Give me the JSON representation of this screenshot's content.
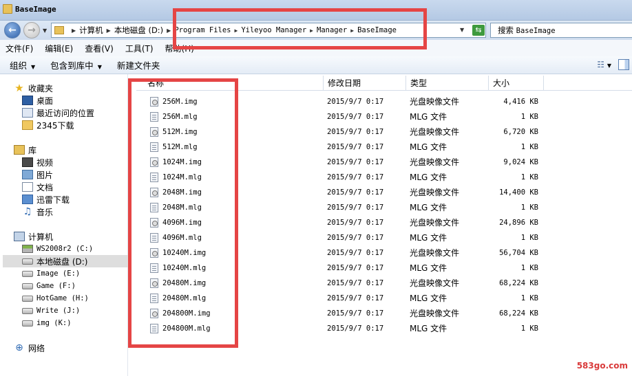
{
  "window": {
    "title": "BaseImage"
  },
  "nav": {
    "back_arrow": "←",
    "forward_arrow": "→",
    "breadcrumbs": [
      "计算机",
      "本地磁盘 (D:)",
      "Program Files",
      "Yileyoo Manager",
      "Manager",
      "BaseImage"
    ],
    "search_placeholder": "搜索 BaseImage",
    "search_prefix": "搜索",
    "search_target": "BaseImage"
  },
  "menubar": [
    "文件(F)",
    "编辑(E)",
    "查看(V)",
    "工具(T)",
    "帮助(H)"
  ],
  "toolbar": {
    "organize": "组织",
    "include_in_library": "包含到库中",
    "new_folder": "新建文件夹"
  },
  "sidebar": {
    "favorites": {
      "label": "收藏夹",
      "items": [
        "桌面",
        "最近访问的位置",
        "2345下载"
      ]
    },
    "libraries": {
      "label": "库",
      "items": [
        "视频",
        "图片",
        "文档",
        "迅雷下载",
        "音乐"
      ]
    },
    "computer": {
      "label": "计算机",
      "drives": [
        "WS2008r2 (C:)",
        "本地磁盘 (D:)",
        "Image (E:)",
        "Game (F:)",
        "HotGame (H:)",
        "Write (J:)",
        "img (K:)"
      ],
      "selected_index": 1
    },
    "network": {
      "label": "网络"
    }
  },
  "columns": {
    "name": "名称",
    "date": "修改日期",
    "type": "类型",
    "size": "大小"
  },
  "files": [
    {
      "name": "256M.img",
      "date": "2015/9/7 0:17",
      "type": "光盘映像文件",
      "size": "4,416 KB",
      "kind": "img"
    },
    {
      "name": "256M.mlg",
      "date": "2015/9/7 0:17",
      "type": "MLG 文件",
      "size": "1 KB",
      "kind": "mlg"
    },
    {
      "name": "512M.img",
      "date": "2015/9/7 0:17",
      "type": "光盘映像文件",
      "size": "6,720 KB",
      "kind": "img"
    },
    {
      "name": "512M.mlg",
      "date": "2015/9/7 0:17",
      "type": "MLG 文件",
      "size": "1 KB",
      "kind": "mlg"
    },
    {
      "name": "1024M.img",
      "date": "2015/9/7 0:17",
      "type": "光盘映像文件",
      "size": "9,024 KB",
      "kind": "img"
    },
    {
      "name": "1024M.mlg",
      "date": "2015/9/7 0:17",
      "type": "MLG 文件",
      "size": "1 KB",
      "kind": "mlg"
    },
    {
      "name": "2048M.img",
      "date": "2015/9/7 0:17",
      "type": "光盘映像文件",
      "size": "14,400 KB",
      "kind": "img"
    },
    {
      "name": "2048M.mlg",
      "date": "2015/9/7 0:17",
      "type": "MLG 文件",
      "size": "1 KB",
      "kind": "mlg"
    },
    {
      "name": "4096M.img",
      "date": "2015/9/7 0:17",
      "type": "光盘映像文件",
      "size": "24,896 KB",
      "kind": "img"
    },
    {
      "name": "4096M.mlg",
      "date": "2015/9/7 0:17",
      "type": "MLG 文件",
      "size": "1 KB",
      "kind": "mlg"
    },
    {
      "name": "10240M.img",
      "date": "2015/9/7 0:17",
      "type": "光盘映像文件",
      "size": "56,704 KB",
      "kind": "img"
    },
    {
      "name": "10240M.mlg",
      "date": "2015/9/7 0:17",
      "type": "MLG 文件",
      "size": "1 KB",
      "kind": "mlg"
    },
    {
      "name": "20480M.img",
      "date": "2015/9/7 0:17",
      "type": "光盘映像文件",
      "size": "68,224 KB",
      "kind": "img"
    },
    {
      "name": "20480M.mlg",
      "date": "2015/9/7 0:17",
      "type": "MLG 文件",
      "size": "1 KB",
      "kind": "mlg"
    },
    {
      "name": "204800M.img",
      "date": "2015/9/7 0:17",
      "type": "光盘映像文件",
      "size": "68,224 KB",
      "kind": "img"
    },
    {
      "name": "204800M.mlg",
      "date": "2015/9/7 0:17",
      "type": "MLG 文件",
      "size": "1 KB",
      "kind": "mlg"
    }
  ],
  "watermark": "583go.com",
  "colors": {
    "annotation": "#e54545",
    "title_bar": "#c9d9ee",
    "selection": "#dedede"
  }
}
